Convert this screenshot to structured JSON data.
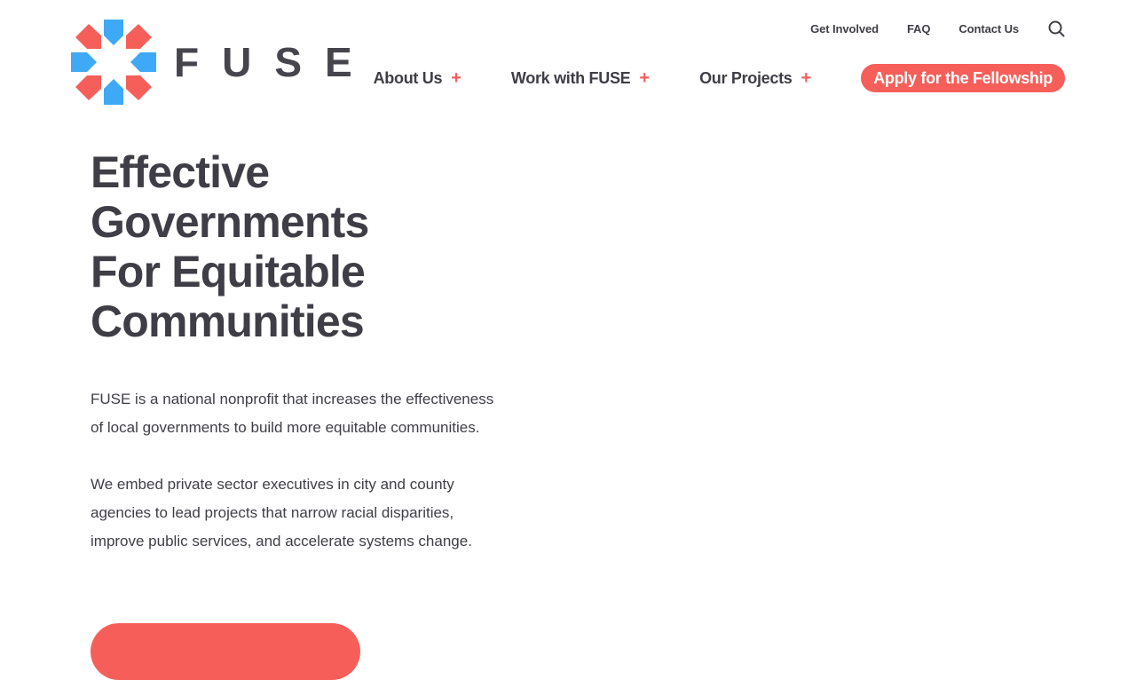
{
  "brand": {
    "wordmark": "FUSE",
    "colors": {
      "coral": "#f65f59",
      "blue": "#3ea9f5",
      "text": "#3f3e46"
    }
  },
  "utility_nav": {
    "items": [
      {
        "label": "Get Involved"
      },
      {
        "label": "FAQ"
      },
      {
        "label": "Contact Us"
      }
    ],
    "search_icon": "search-icon"
  },
  "main_nav": {
    "items": [
      {
        "label": "About Us",
        "expand_icon": "plus-icon"
      },
      {
        "label": "Work with FUSE",
        "expand_icon": "plus-icon"
      },
      {
        "label": "Our Projects",
        "expand_icon": "plus-icon"
      }
    ],
    "cta_label": "Apply for the Fellowship"
  },
  "hero": {
    "title_lines": [
      "Effective",
      "Governments",
      "For Equitable",
      "Communities"
    ],
    "paragraphs": [
      "FUSE is a national nonprofit that increases the effectiveness of local governments to build more equitable communities.",
      "We embed private sector executives in city and county agencies to lead projects that narrow racial disparities, improve public services, and accelerate systems change."
    ]
  }
}
